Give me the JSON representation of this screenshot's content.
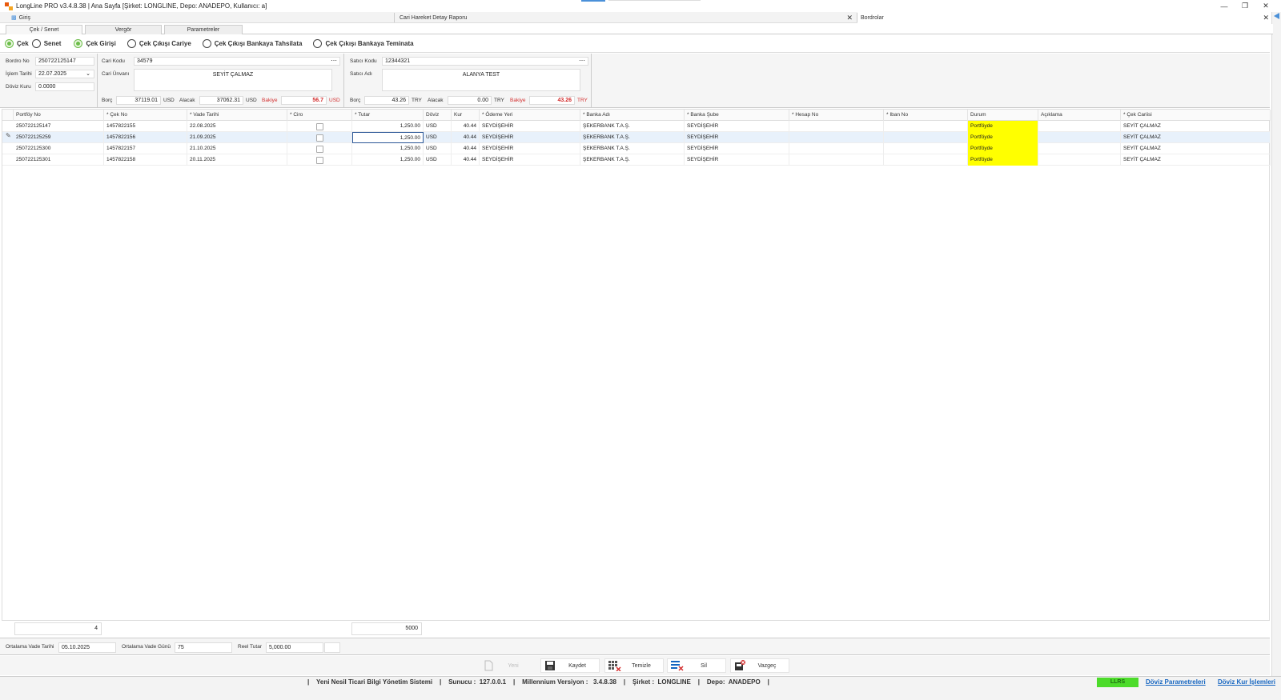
{
  "window": {
    "title": "LongLine PRO v3.4.8.38 | Ana Sayfa [Şirket: LONGLINE, Depo: ANADEPO, Kullanıcı: a]"
  },
  "doc_tabs": [
    {
      "label": "Giriş"
    },
    {
      "label": "Cari Hareket Detay Raporu"
    },
    {
      "label": "Bordrolar"
    }
  ],
  "inner_tabs": [
    {
      "label": "Çek / Senet"
    },
    {
      "label": "Vergör"
    },
    {
      "label": "Parametreler"
    }
  ],
  "type_radios": [
    {
      "label": "Çek",
      "checked": true
    },
    {
      "label": "Senet",
      "checked": false
    }
  ],
  "op_radios": [
    {
      "label": "Çek Girişi",
      "checked": true
    },
    {
      "label": "Çek Çıkışı Cariye",
      "checked": false
    },
    {
      "label": "Çek Çıkışı Bankaya Tahsilata",
      "checked": false
    },
    {
      "label": "Çek Çıkışı Bankaya Teminata",
      "checked": false
    }
  ],
  "form": {
    "bordro_no_label": "Bordro No",
    "bordro_no": "250722125147",
    "islem_tarihi_label": "İşlem Tarihi",
    "islem_tarihi": "22.07.2025",
    "doviz_kuru_label": "Döviz Kuru",
    "doviz_kuru": "0.0000",
    "cari_kodu_label": "Cari Kodu",
    "cari_kodu": "34579",
    "cari_unvani_label": "Cari Ünvanı",
    "cari_unvani": "SEYİT ÇALMAZ",
    "satici_kodu_label": "Satıcı Kodu",
    "satici_kodu": "12344321",
    "satici_adi_label": "Satıcı Adı",
    "satici_adi": "ALANYA TEST",
    "borc_label": "Borç",
    "alacak_label": "Alacak",
    "bakiye_label": "Bakiye",
    "cari_borc": "37119.01",
    "cari_alacak": "37062.31",
    "cari_bakiye": "56.7",
    "cari_currency": "USD",
    "satici_borc": "43.26",
    "satici_alacak": "0.00",
    "satici_bakiye": "43.26",
    "satici_currency": "TRY"
  },
  "grid": {
    "columns": [
      "Portföy No",
      "* Çek No",
      "* Vade Tarihi",
      "* Ciro",
      "* Tutar",
      "Döviz",
      "Kur",
      "* Ödeme Yeri",
      "* Banka Adı",
      "* Banka Şube",
      "* Hesap No",
      "* Iban No",
      "Durum",
      "Açıklama",
      "* Çek Cariisi"
    ],
    "rows": [
      {
        "portfoy_no": "250722125147",
        "cek_no": "1457822155",
        "vade_tarihi": "22.08.2025",
        "tutar": "1,250.00",
        "doviz": "USD",
        "kur": "40.44",
        "odeme_yeri": "SEYDİŞEHİR",
        "banka_adi": "ŞEKERBANK T.A.Ş.",
        "banka_sube": "SEYDİŞEHİR",
        "hesap_no": "",
        "iban_no": "",
        "durum": "Portföyde",
        "aciklama": "",
        "cek_carisi": "SEYİT ÇALMAZ"
      },
      {
        "portfoy_no": "250722125259",
        "cek_no": "1457822156",
        "vade_tarihi": "21.09.2025",
        "tutar": "1,250.00",
        "doviz": "USD",
        "kur": "40.44",
        "odeme_yeri": "SEYDİŞEHİR",
        "banka_adi": "ŞEKERBANK T.A.Ş.",
        "banka_sube": "SEYDİŞEHİR",
        "hesap_no": "",
        "iban_no": "",
        "durum": "Portföyde",
        "aciklama": "",
        "cek_carisi": "SEYİT ÇALMAZ"
      },
      {
        "portfoy_no": "250722125300",
        "cek_no": "1457822157",
        "vade_tarihi": "21.10.2025",
        "tutar": "1,250.00",
        "doviz": "USD",
        "kur": "40.44",
        "odeme_yeri": "SEYDİŞEHİR",
        "banka_adi": "ŞEKERBANK T.A.Ş.",
        "banka_sube": "SEYDİŞEHİR",
        "hesap_no": "",
        "iban_no": "",
        "durum": "Portföyde",
        "aciklama": "",
        "cek_carisi": "SEYİT ÇALMAZ"
      },
      {
        "portfoy_no": "250722125301",
        "cek_no": "1457822158",
        "vade_tarihi": "20.11.2025",
        "tutar": "1,250.00",
        "doviz": "USD",
        "kur": "40.44",
        "odeme_yeri": "SEYDİŞEHİR",
        "banka_adi": "ŞEKERBANK T.A.Ş.",
        "banka_sube": "SEYDİŞEHİR",
        "hesap_no": "",
        "iban_no": "",
        "durum": "Portföyde",
        "aciklama": "",
        "cek_carisi": "SEYİT ÇALMAZ"
      }
    ],
    "durum_color": "#ffff00"
  },
  "totals": {
    "count": "4",
    "tutar_sum": "5000"
  },
  "summary": {
    "ort_vade_tarihi_label": "Ortalama Vade Tarihi",
    "ort_vade_tarihi": "05.10.2025",
    "ort_vade_gunu_label": "Ortalama Vade Günü",
    "ort_vade_gunu": "75",
    "reel_tutar_label": "Reel Tutar",
    "reel_tutar": "5,000.00"
  },
  "toolbar": {
    "yeni": "Yeni",
    "kaydet": "Kaydet",
    "temizle": "Temizle",
    "sil": "Sil",
    "vazgec": "Vazgeç"
  },
  "status": {
    "text": "|    Yeni Nesil Ticari Bilgi Yönetim Sistemi    |    Sunucu :  127.0.0.1    |    Millennium Versiyon :   3.4.8.38    |    Şirket :  LONGLINE    |    Depo:  ANADEPO    |",
    "badge": "LLRS",
    "badge_color": "#4cdb2a",
    "link1": "Döviz Parametreleri",
    "link2": "Döviz Kur İşlemleri"
  }
}
